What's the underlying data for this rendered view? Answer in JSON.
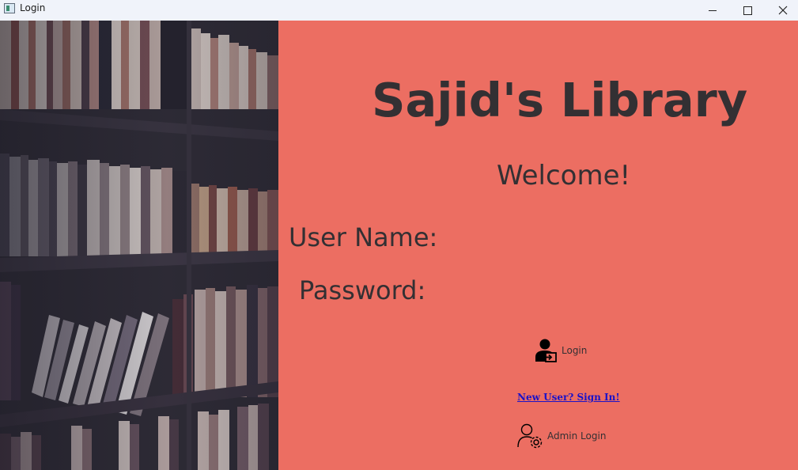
{
  "window": {
    "title": "Login",
    "controls": [
      "minimize",
      "maximize",
      "close"
    ]
  },
  "left_image": {
    "subject": "bookshelf"
  },
  "main": {
    "app_title": "Sajid's Library",
    "welcome": "Welcome!",
    "username_label": "User Name:",
    "password_label": "Password:",
    "username_value": "",
    "password_value": "",
    "login_button": {
      "label": "Login",
      "icon": "user-login-icon"
    },
    "signup_link": "New User? Sign In!",
    "admin_button": {
      "label": "Admin Login",
      "icon": "user-gear-icon"
    }
  },
  "colors": {
    "panel_bg": "#ec6e62",
    "text": "#333033",
    "link": "#1a12c8",
    "titlebar_bg": "#f0f3fa"
  }
}
